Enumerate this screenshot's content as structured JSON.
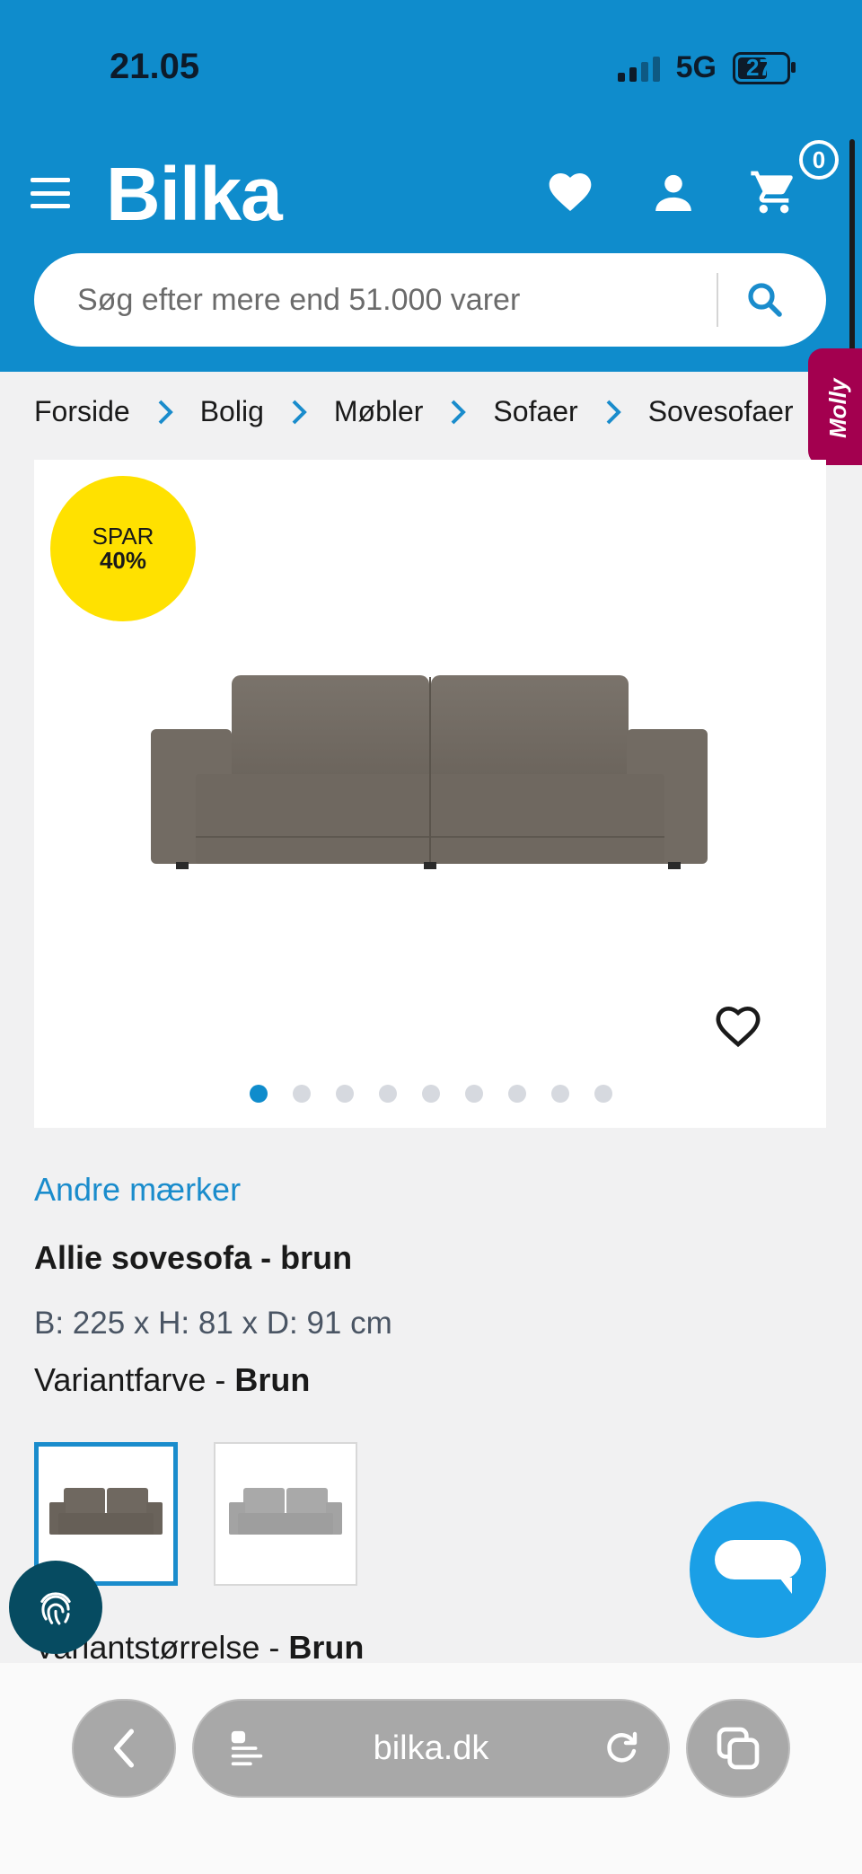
{
  "status_bar": {
    "time": "21.05",
    "network": "5G",
    "battery": "27"
  },
  "header": {
    "logo": "Bilka",
    "cart_count": "0",
    "icons": [
      "menu-icon",
      "heart-icon",
      "user-icon",
      "cart-icon"
    ],
    "brand_color": "#0f8ccc"
  },
  "search": {
    "placeholder": "Søg efter mere end 51.000 varer"
  },
  "breadcrumb": [
    "Forside",
    "Bolig",
    "Møbler",
    "Sofaer",
    "Sovesofaer"
  ],
  "side_tab": {
    "label": "Molly"
  },
  "product": {
    "discount_line1": "SPAR",
    "discount_line2": "40%",
    "image_count": 9,
    "active_image": 1,
    "brand": "Andre mærker",
    "title": "Allie sovesofa - brun",
    "dimensions": "B: 225 x H: 81 x D: 91 cm",
    "variant_label": "Variantfarve - ",
    "variant_value": "Brun",
    "swatches": [
      "Brun",
      "Grå"
    ],
    "selected_swatch": "Brun",
    "size_label": "Variantstørrelse - ",
    "size_value": "Brun"
  },
  "browser": {
    "url": "bilka.dk"
  }
}
